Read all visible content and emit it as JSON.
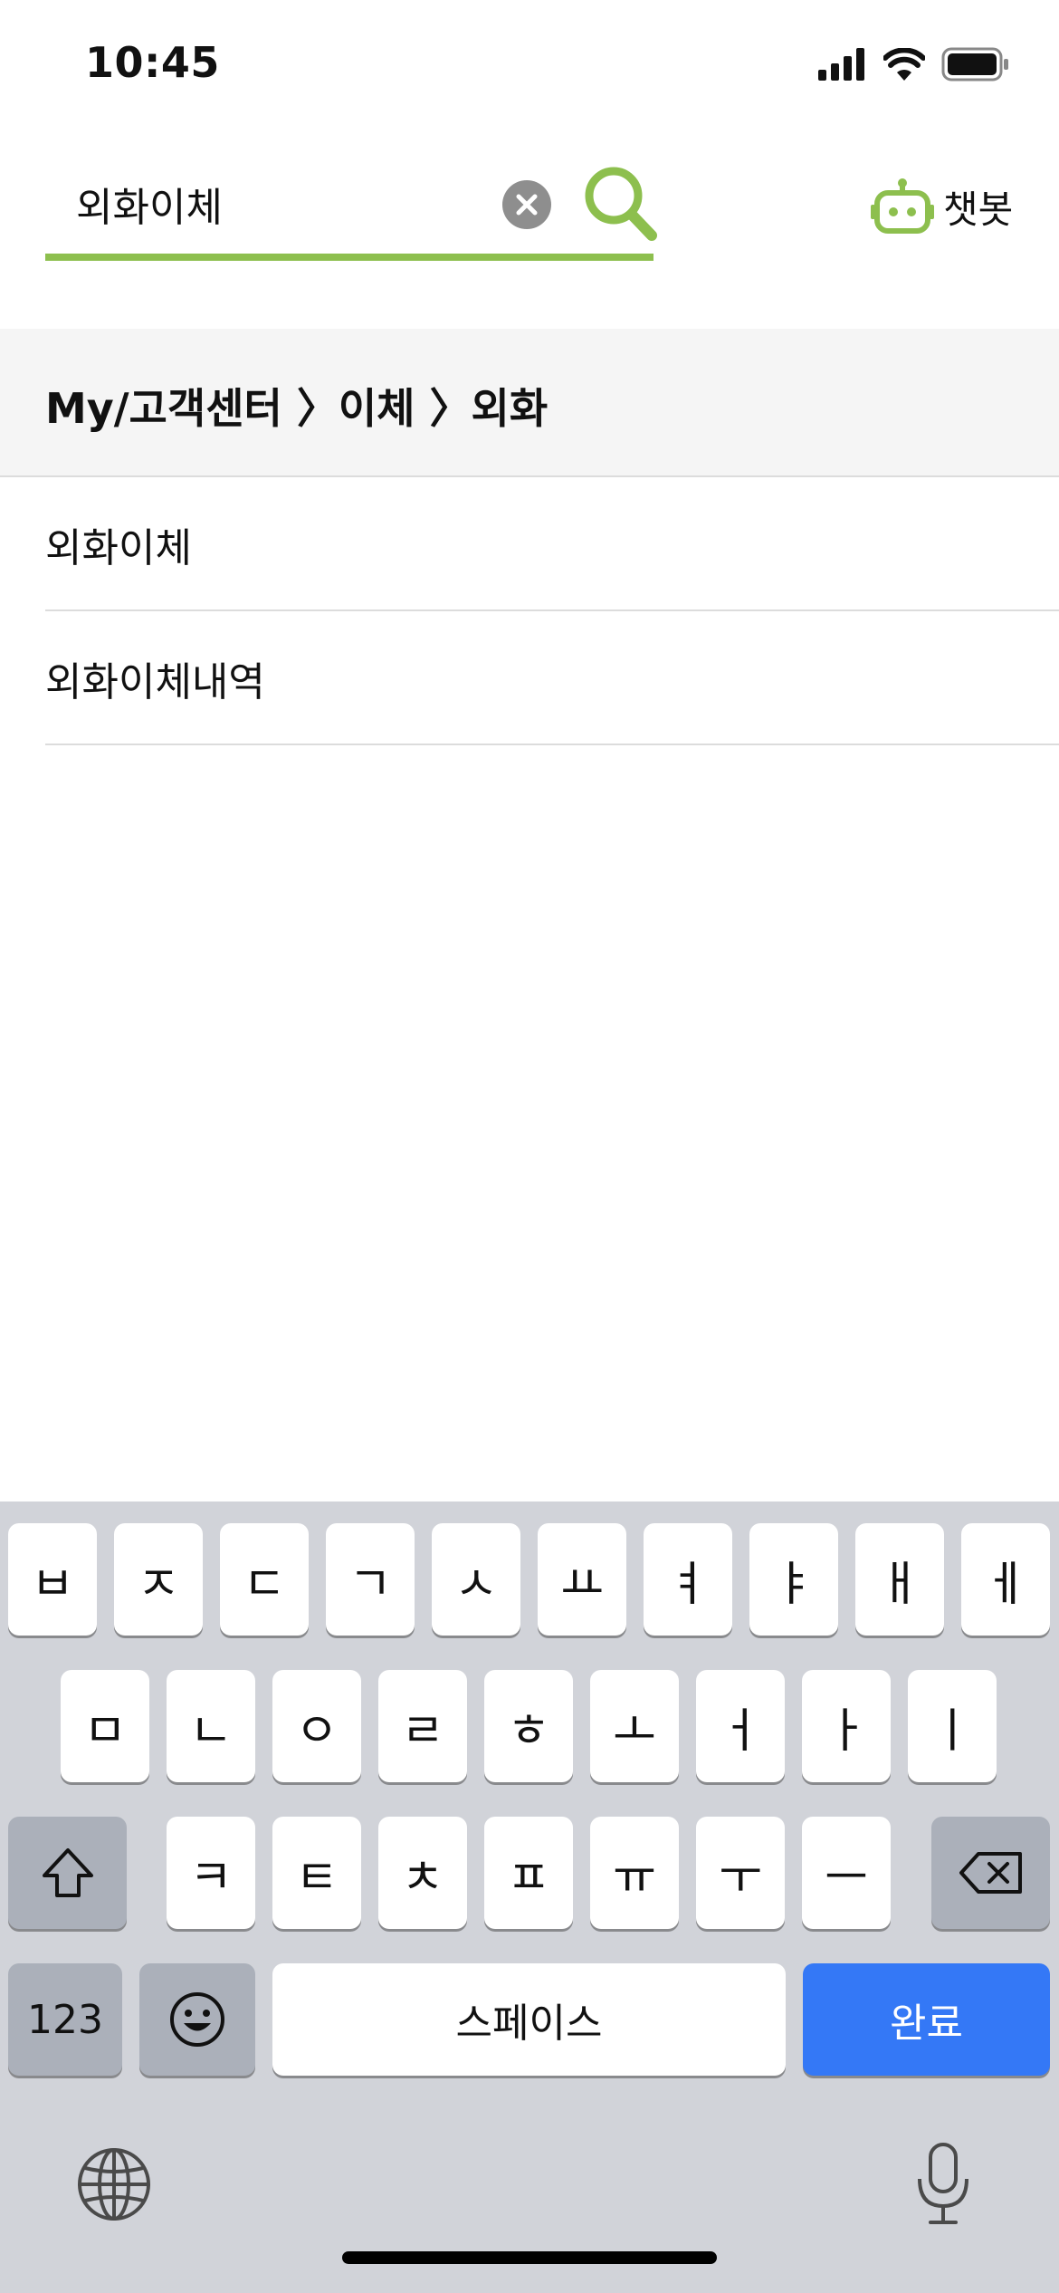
{
  "status": {
    "time": "10:45"
  },
  "search": {
    "value": "외화이체"
  },
  "chatbot": {
    "label": "챗봇"
  },
  "breadcrumb": {
    "text": "My/고객센터 〉이체 〉외화"
  },
  "results": [
    {
      "label": "외화이체"
    },
    {
      "label": "외화이체내역"
    }
  ],
  "keyboard": {
    "row1": [
      "ㅂ",
      "ㅈ",
      "ㄷ",
      "ㄱ",
      "ㅅ",
      "ㅛ",
      "ㅕ",
      "ㅑ",
      "ㅐ",
      "ㅔ"
    ],
    "row2": [
      "ㅁ",
      "ㄴ",
      "ㅇ",
      "ㄹ",
      "ㅎ",
      "ㅗ",
      "ㅓ",
      "ㅏ",
      "ㅣ"
    ],
    "row3": [
      "ㅋ",
      "ㅌ",
      "ㅊ",
      "ㅍ",
      "ㅠ",
      "ㅜ",
      "ㅡ"
    ],
    "numbers_label": "123",
    "space_label": "스페이스",
    "done_label": "완료"
  },
  "colors": {
    "accent": "#8dbf4e",
    "keyboard_bg": "#d1d3d9",
    "done_button": "#3478f6"
  }
}
